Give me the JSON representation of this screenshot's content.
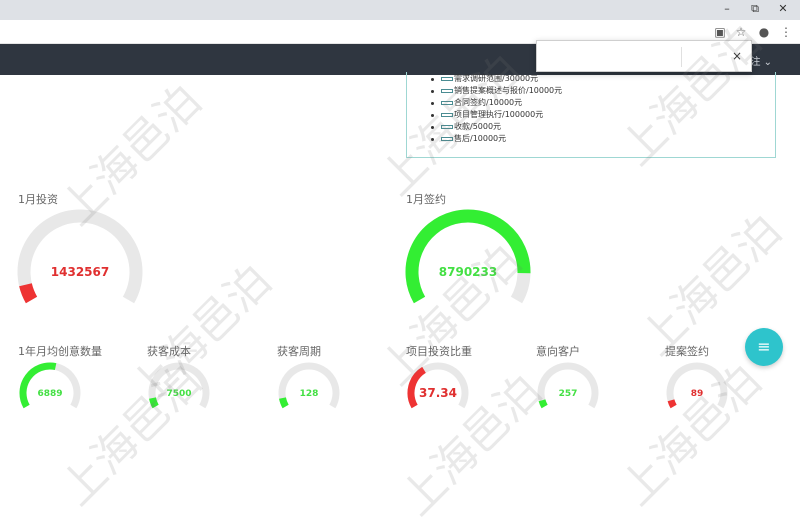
{
  "window": {
    "minimize_icon": "minimize-icon",
    "restore_icon": "restore-icon",
    "close_icon": "close-icon"
  },
  "header": {
    "user_menu_label": "注 ⌄"
  },
  "popup": {
    "close_label": "×"
  },
  "legend": {
    "items": [
      {
        "label": "需求调研范围/30000元"
      },
      {
        "label": "销售提案概述与报价/10000元"
      },
      {
        "label": "合同签约/10000元"
      },
      {
        "label": "项目管理执行/100000元"
      },
      {
        "label": "收款/5000元"
      },
      {
        "label": "售后/10000元"
      }
    ]
  },
  "gauges_large": [
    {
      "title": "1月投资",
      "value": "1432567",
      "fraction": 0.07,
      "color": "#ee3333"
    },
    {
      "title": "1月签约",
      "value": "8790233",
      "fraction": 0.88,
      "color": "#33ee33"
    }
  ],
  "gauges_small": [
    {
      "title": "1年月均创意数量",
      "value": "6889",
      "fraction": 0.55,
      "color": "#33ee33"
    },
    {
      "title": "获客成本",
      "value": "7500",
      "fraction": 0.08,
      "color": "#33ee33"
    },
    {
      "title": "获客周期",
      "value": "128",
      "fraction": 0.08,
      "color": "#33ee33"
    },
    {
      "title": "项目投资比重",
      "value": "37.34",
      "fraction": 0.37,
      "color": "#ee3333"
    },
    {
      "title": "意向客户",
      "value": "257",
      "fraction": 0.06,
      "color": "#33ee33"
    },
    {
      "title": "提案签约",
      "value": "89",
      "fraction": 0.06,
      "color": "#ee3333"
    }
  ],
  "fab": {
    "icon": "menu-icon",
    "label": "≡"
  },
  "watermark": {
    "text": "上海邑泊"
  },
  "colors": {
    "track": "#e8e8e8",
    "teal": "#2ec4cc",
    "header": "#2f3640"
  }
}
